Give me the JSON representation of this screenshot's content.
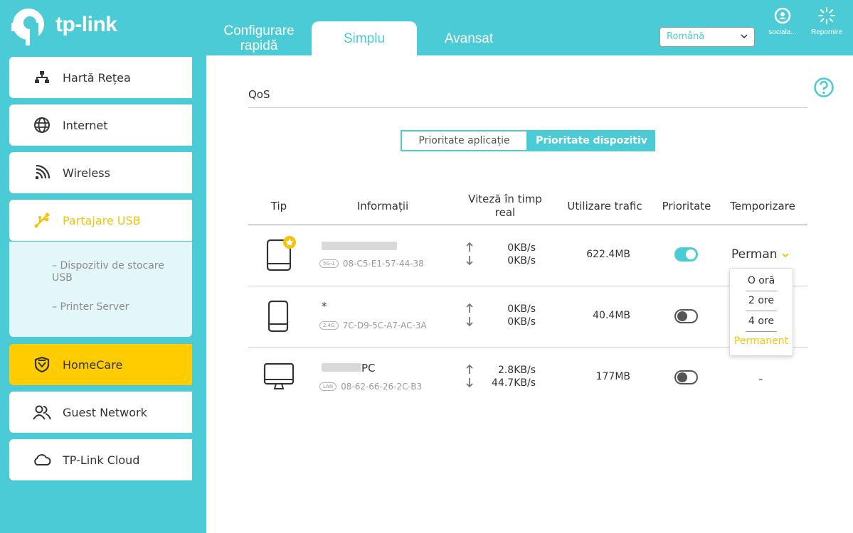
{
  "brand": {
    "logo_text": "tp-link"
  },
  "top_tabs": [
    {
      "label": "Configurare rapidă",
      "active": false
    },
    {
      "label": "Simplu",
      "active": true
    },
    {
      "label": "Avansat",
      "active": false
    }
  ],
  "language": {
    "selected": "Română"
  },
  "top_icons": [
    {
      "label": "sociala...",
      "icon": "social-icon"
    },
    {
      "label": "Repornire",
      "icon": "reboot-icon"
    }
  ],
  "sidebar": {
    "items": [
      {
        "label": "Hartă Rețea",
        "icon": "network-map-icon"
      },
      {
        "label": "Internet",
        "icon": "globe-icon"
      },
      {
        "label": "Wireless",
        "icon": "wireless-icon"
      },
      {
        "label": "Partajare USB",
        "icon": "usb-icon"
      },
      {
        "label": "HomeCare",
        "icon": "shield-icon"
      },
      {
        "label": "Guest Network",
        "icon": "guest-icon"
      },
      {
        "label": "TP-Link Cloud",
        "icon": "cloud-icon"
      }
    ],
    "usb_sub": [
      "Dispozitiv de stocare USB",
      "Printer Server"
    ]
  },
  "qos": {
    "title": "QoS",
    "segments": [
      "Prioritate aplicație",
      "Prioritate dispozitiv"
    ],
    "active_segment": "Prioritate dispozitiv",
    "headers": {
      "type": "Tip",
      "info": "Informații",
      "speed": "Viteză în timp real",
      "traffic": "Utilizare trafic",
      "priority": "Prioritate",
      "timing": "Temporizare"
    },
    "devices": [
      {
        "type": "tablet-icon",
        "name": "",
        "band": "5G-1",
        "mac": "08-C5-E1-57-44-38",
        "up": "0KB/s",
        "down": "0KB/s",
        "traffic": "622.4MB",
        "priority": true,
        "timing": "Perman"
      },
      {
        "type": "phone-icon",
        "name": "*",
        "band": "2.4G",
        "mac": "7C-D9-5C-A7-AC-3A",
        "up": "0KB/s",
        "down": "0KB/s",
        "traffic": "40.4MB",
        "priority": false,
        "timing": ""
      },
      {
        "type": "desktop-icon",
        "name": "PC",
        "band": "LAN",
        "mac": "08-62-66-26-2C-B3",
        "up": "2.8KB/s",
        "down": "44.7KB/s",
        "traffic": "177MB",
        "priority": false,
        "timing": "-"
      }
    ],
    "timing_options": [
      "O oră",
      "2 ore",
      "4 ore",
      "Permanent"
    ],
    "timing_selected": "Permanent"
  },
  "colors": {
    "accent": "#4acbd6",
    "highlight": "#ffcc00"
  }
}
